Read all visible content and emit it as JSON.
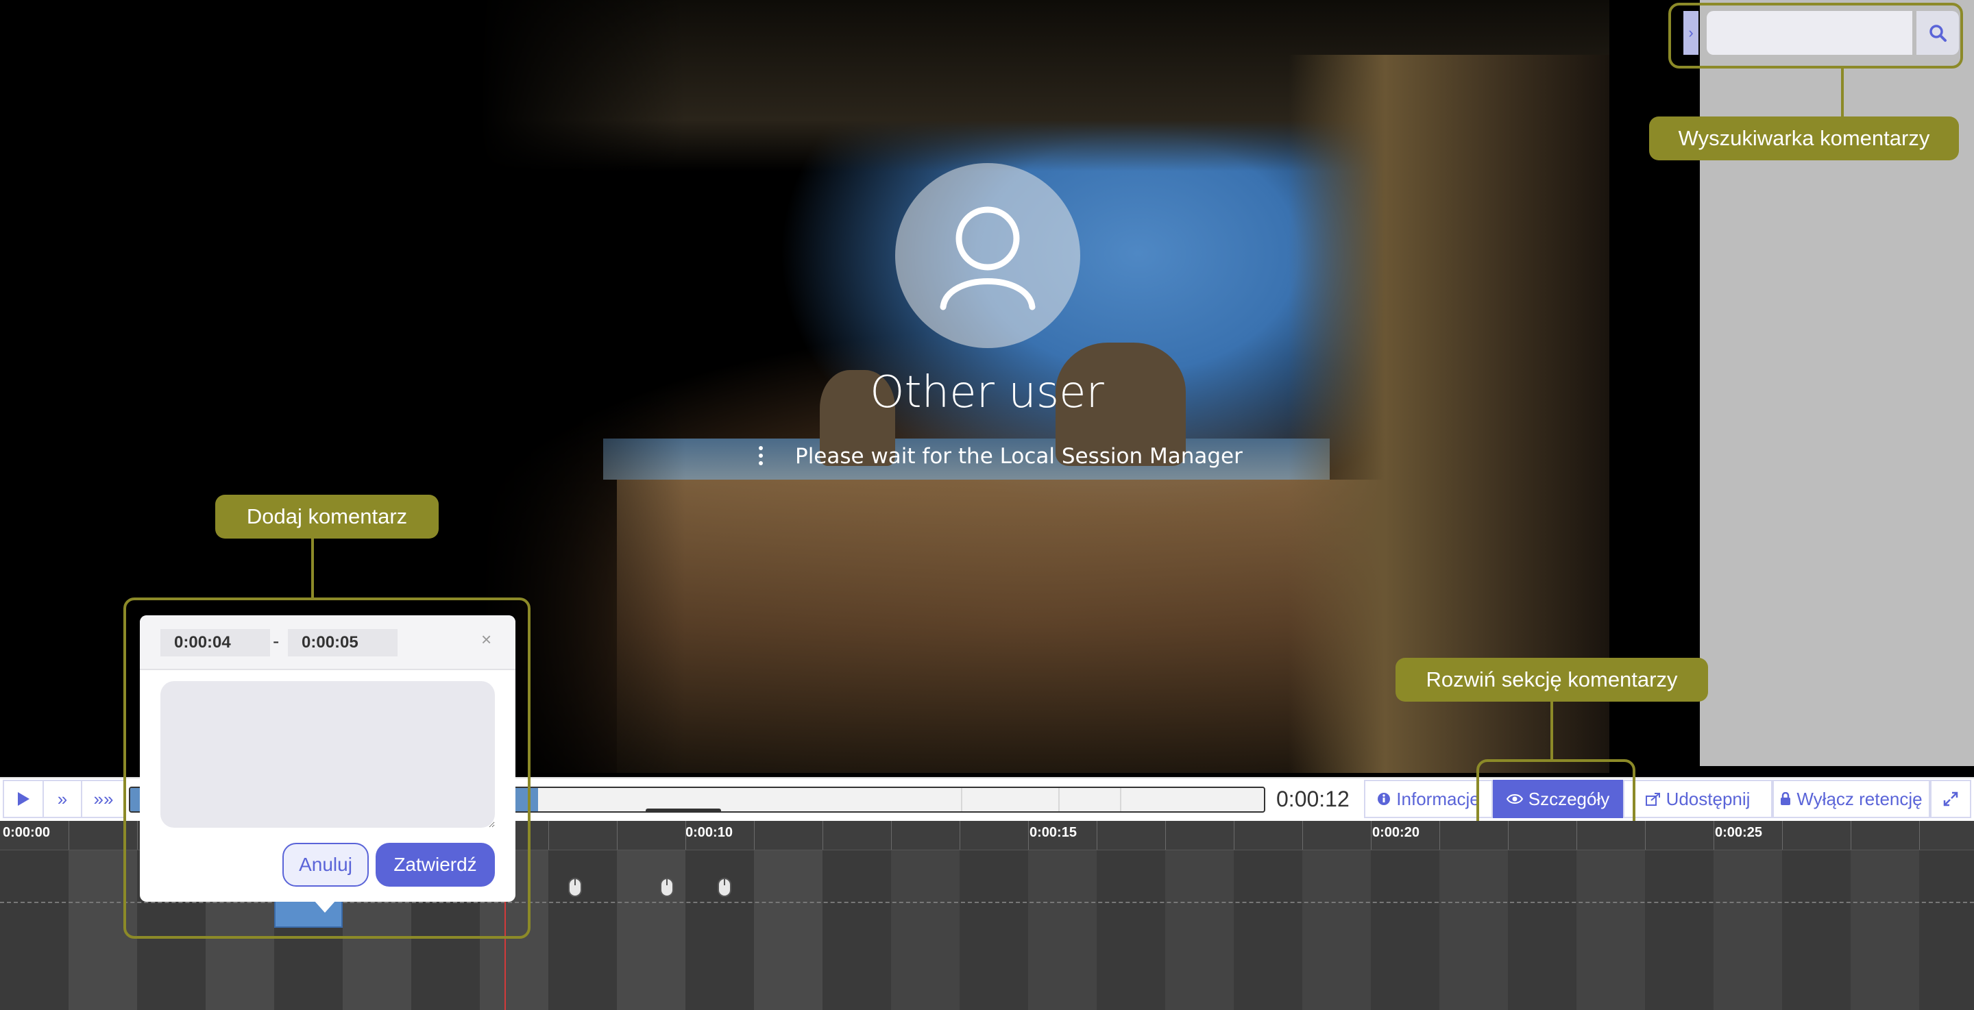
{
  "screen": {
    "username": "Other user",
    "status_message": "Please wait for the Local Session Manager"
  },
  "search": {
    "placeholder": "",
    "icons": {
      "toggle": "chevron-right-icon",
      "search": "search-icon"
    }
  },
  "callouts": {
    "search": "Wyszukiwarka komentarzy",
    "add_comment": "Dodaj komentarz",
    "expand_comments": "Rozwiń sekcję komentarzy"
  },
  "controls": {
    "play_icon": "play-icon",
    "forward_icon": "fast-forward-icon",
    "faster_icon": "fastest-forward-icon",
    "progress_fraction": 0.36,
    "current_time": "0:00:12"
  },
  "toolbar": {
    "info_label": "Informacje",
    "details_label": "Szczegóły",
    "share_label": "Udostępnij",
    "retention_label": "Wyłącz retencję",
    "fullscreen_icon": "fullscreen-icon"
  },
  "timeline": {
    "ticks": [
      "0:00:00",
      "0:00:10",
      "0:00:15",
      "0:00:20",
      "0:00:25"
    ]
  },
  "comment_dialog": {
    "start_time": "0:00:04",
    "end_time": "0:00:05",
    "separator": "-",
    "close_label": "×",
    "comment_value": "",
    "cancel_label": "Anuluj",
    "confirm_label": "Zatwierdź"
  },
  "colors": {
    "accent": "#5a64d8",
    "callout": "#8c8a28",
    "progress": "#5f8fc4",
    "playhead": "#d23a3a"
  }
}
